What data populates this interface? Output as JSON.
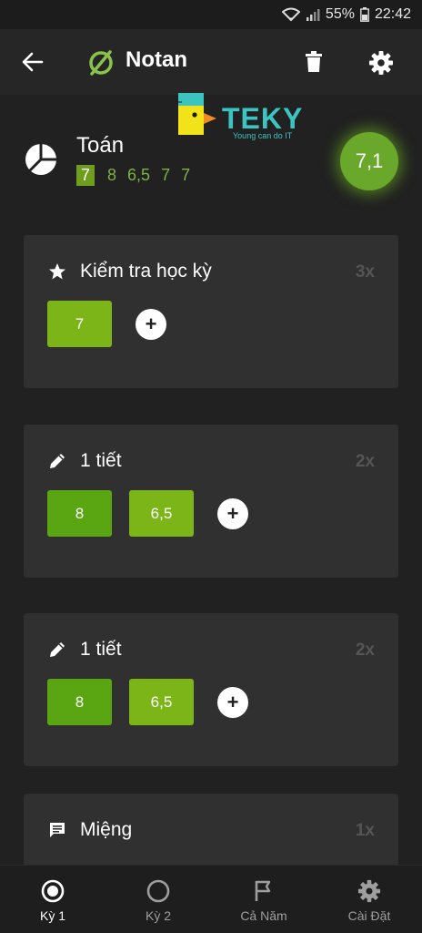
{
  "status_bar": {
    "battery": "55%",
    "time": "22:42"
  },
  "app_bar": {
    "title": "Notan",
    "icons": [
      "arrow-left-icon",
      "notan-logo-icon",
      "trash-icon",
      "gear-icon"
    ]
  },
  "subject": {
    "name": "Toán",
    "grades": [
      "7",
      "8",
      "6,5",
      "7",
      "7"
    ],
    "average": "7,1"
  },
  "watermark": {
    "brand": "TEKY",
    "tagline": "Young can do IT"
  },
  "cards": [
    {
      "icon": "star-icon",
      "title": "Kiểm tra học kỳ",
      "weight": "3x",
      "marks": [
        "7"
      ]
    },
    {
      "icon": "pencil-icon",
      "title": "1 tiết",
      "weight": "2x",
      "marks": [
        "8",
        "6,5"
      ]
    },
    {
      "icon": "pencil-icon",
      "title": "1 tiết",
      "weight": "2x",
      "marks": [
        "8",
        "6,5"
      ]
    },
    {
      "icon": "chat-icon",
      "title": "Miệng",
      "weight": "1x",
      "marks": []
    }
  ],
  "add_label": "+",
  "bottom_nav": [
    {
      "label": "Kỳ 1",
      "icon": "radio-checked-icon",
      "active": true
    },
    {
      "label": "Kỳ 2",
      "icon": "circle-icon",
      "active": false
    },
    {
      "label": "Cả Năm",
      "icon": "flag-icon",
      "active": false
    },
    {
      "label": "Cài Đặt",
      "icon": "gear-icon",
      "active": false
    }
  ],
  "colors": {
    "background": "#212121",
    "card": "#303030",
    "accent": "#7cb518",
    "average": "#69a82a"
  }
}
